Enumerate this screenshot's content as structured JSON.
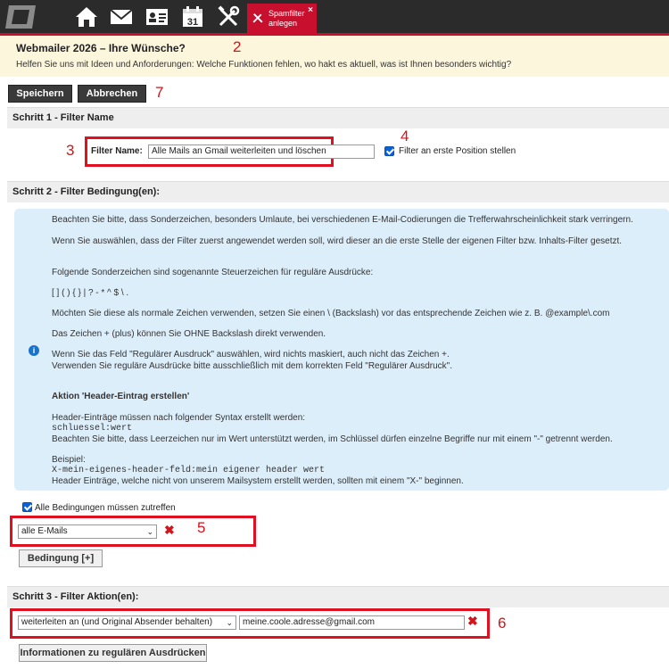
{
  "topbar": {
    "icons": [
      "logo-icon",
      "home-icon",
      "mail-icon",
      "contact-card-icon",
      "calendar-icon",
      "tools-icon"
    ],
    "calendar_day": "31",
    "active_tab": {
      "line1": "Spamfilter",
      "line2": "anlegen",
      "close": "×"
    }
  },
  "banner": {
    "title": "Webmailer 2026 – Ihre Wünsche?",
    "text": "Helfen Sie uns mit Ideen und Anforderungen: Welche Funktionen fehlen, wo hakt es aktuell, was ist Ihnen besonders wichtig?"
  },
  "annotations": {
    "a2": "2",
    "a3": "3",
    "a4": "4",
    "a5": "5",
    "a6": "6",
    "a7": "7"
  },
  "toolbar": {
    "save": "Speichern",
    "cancel": "Abbrechen"
  },
  "step1": {
    "title": "Schritt 1 - Filter Name",
    "name_label": "Filter Name:",
    "name_value": "Alle Mails an Gmail weiterleiten und löschen",
    "first_position_label": "Filter an erste Position stellen",
    "first_position_checked": true
  },
  "step2": {
    "title": "Schritt 2 - Filter Bedingung(en):",
    "info": {
      "p1": "Beachten Sie bitte, dass Sonderzeichen, besonders Umlaute, bei verschiedenen E-Mail-Codierungen die Trefferwahrscheinlichkeit stark verringern.",
      "p2": "Wenn Sie auswählen, dass der Filter zuerst angewendet werden soll, wird dieser an die erste Stelle der eigenen Filter bzw. Inhalts-Filter gesetzt.",
      "p3": "Folgende Sonderzeichen sind sogenannte Steuerzeichen für reguläre Ausdrücke:",
      "p4": "[ ] ( ) { } | ? - * ^ $ \\ .",
      "p5": "Möchten Sie diese als normale Zeichen verwenden, setzen Sie einen \\ (Backslash) vor das entsprechende Zeichen wie z. B. @example\\.com",
      "p6": "Das Zeichen + (plus) können Sie OHNE Backslash direkt verwenden.",
      "p7": "Wenn Sie das Feld \"Regulärer Ausdruck\" auswählen, wird nichts maskiert, auch nicht das Zeichen +.",
      "p8": "Verwenden Sie reguläre Ausdrücke bitte ausschließlich mit dem korrekten Feld \"Regulärer Ausdruck\".",
      "h1": "Aktion 'Header-Eintrag erstellen'",
      "p9": "Header-Einträge müssen nach folgender Syntax erstellt werden:",
      "code1": "schluessel:wert",
      "p10": "Beachten Sie bitte, dass Leerzeichen nur im Wert unterstützt werden, im Schlüssel dürfen einzelne Begriffe nur mit einem \"-\" getrennt werden.",
      "p11": "Beispiel:",
      "code2": "X-mein-eigenes-header-feld:mein eigener header wert",
      "p12": "Header Einträge, welche nicht von unserem Mailsystem erstellt werden, sollten mit einem \"X-\" beginnen."
    },
    "all_conditions_label": "Alle Bedingungen müssen zutreffen",
    "all_conditions_checked": true,
    "condition_select": "alle E-Mails",
    "add_condition": "Bedingung [+]"
  },
  "step3": {
    "title": "Schritt 3 - Filter Aktion(en):",
    "action_select": "weiterleiten an (und Original Absender behalten)",
    "action_value": "meine.coole.adresse@gmail.com",
    "regex_info_button": "Informationen zu regulären Ausdrücken"
  }
}
